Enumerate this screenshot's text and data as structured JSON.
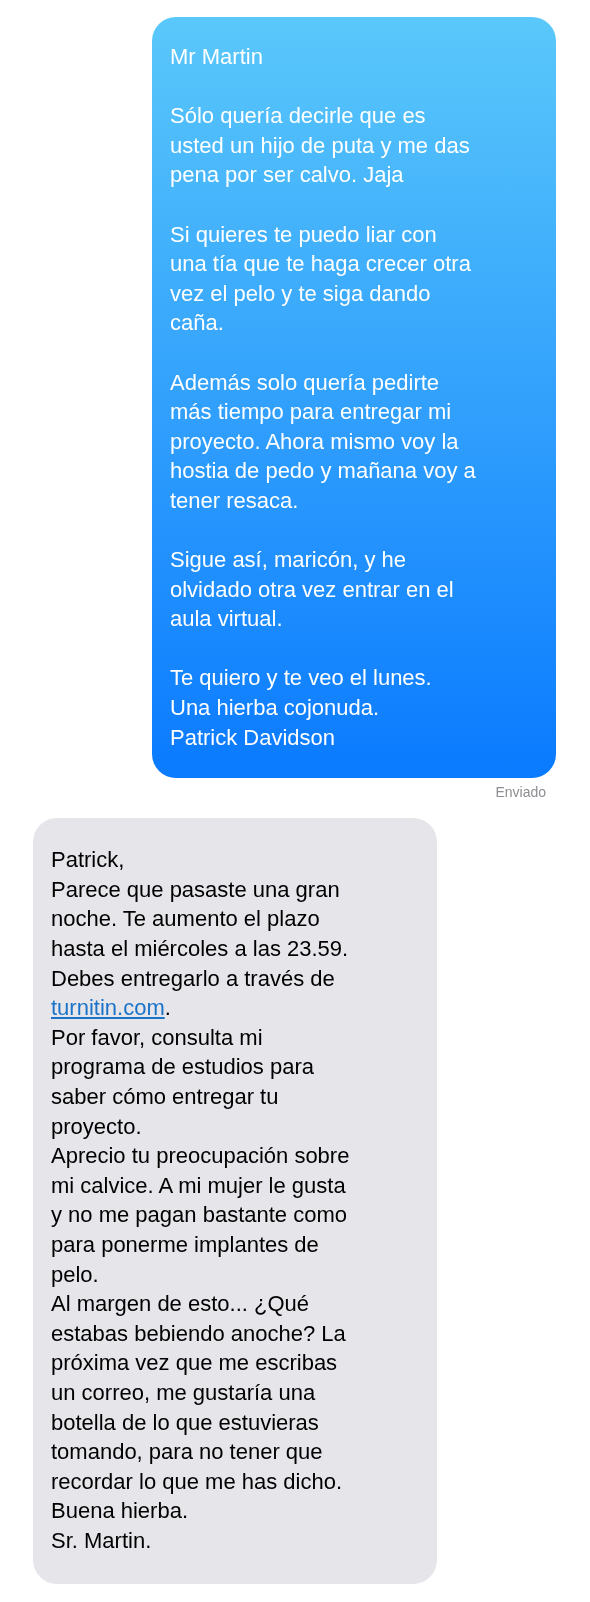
{
  "messages": [
    {
      "kind": "sent",
      "paragraphs": [
        {
          "text": "Mr Martin"
        },
        {
          "text": "Sólo quería decirle que es\nusted un hijo de puta y me das\npena por ser calvo. Jaja"
        },
        {
          "text": "Si quieres te puedo liar con\nuna tía que te haga crecer otra\nvez el pelo y te siga dando\ncaña."
        },
        {
          "text": "Además solo quería pedirte\nmás tiempo para entregar mi\nproyecto. Ahora mismo voy la\nhostia de pedo y mañana voy a\ntener resaca."
        },
        {
          "text": "Sigue así, maricón, y he\nolvidado otra vez entrar en el\naula virtual."
        },
        {
          "text": "Te quiero y te veo el lunes.\nUna hierba cojonuda.\nPatrick Davidson"
        }
      ],
      "status": "Enviado"
    },
    {
      "kind": "received",
      "paragraphs": [
        {
          "text": "Patrick,"
        },
        {
          "text": "Parece que pasaste una gran\nnoche. Te aumento el plazo\nhasta el miércoles a las 23.59."
        },
        {
          "text": "Debes entregarlo a través de\n",
          "link": "turnitin.com",
          "after": "."
        },
        {
          "text": "Por favor, consulta mi\nprograma de estudios para\nsaber cómo entregar tu\nproyecto."
        },
        {
          "text": "Aprecio tu preocupación sobre\nmi calvice. A mi mujer le gusta\ny no me pagan bastante como\npara ponerme implantes de\npelo."
        },
        {
          "text": "Al margen de esto... ¿Qué\nestabas bebiendo anoche? La\npróxima vez que me escribas\nun correo, me gustaría una\nbotella de lo que estuvieras\ntomando, para no tener que\nrecordar lo que me has dicho."
        },
        {
          "text": "Buena hierba."
        },
        {
          "text": "Sr. Martin."
        }
      ]
    }
  ]
}
